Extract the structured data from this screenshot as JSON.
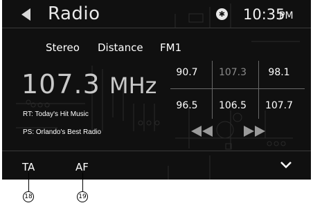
{
  "header": {
    "title": "Radio",
    "bluetooth_icon": "bluetooth-icon",
    "time": "10:35",
    "time_suffix": "PM"
  },
  "modes": [
    "Stereo",
    "Distance",
    "FM1"
  ],
  "frequency": {
    "value": "107.3",
    "unit": "MHz"
  },
  "rds": {
    "rt": "RT: Today's Hit Music",
    "ps": "PS: Orlando's Best Radio"
  },
  "presets": [
    "90.7",
    "107.3",
    "98.1",
    "96.5",
    "106.5",
    "107.7"
  ],
  "active_preset": "107.3",
  "controls": {
    "seek_back_icon": "seek-back-icon",
    "seek_forward_icon": "seek-forward-icon",
    "ta_label": "TA",
    "af_label": "AF",
    "more_icon": "chevron-down-icon"
  },
  "callouts": [
    "18",
    "19"
  ],
  "colors": {
    "background": "#101010",
    "text": "#ffffff",
    "inactive": "#8a8a8a"
  }
}
